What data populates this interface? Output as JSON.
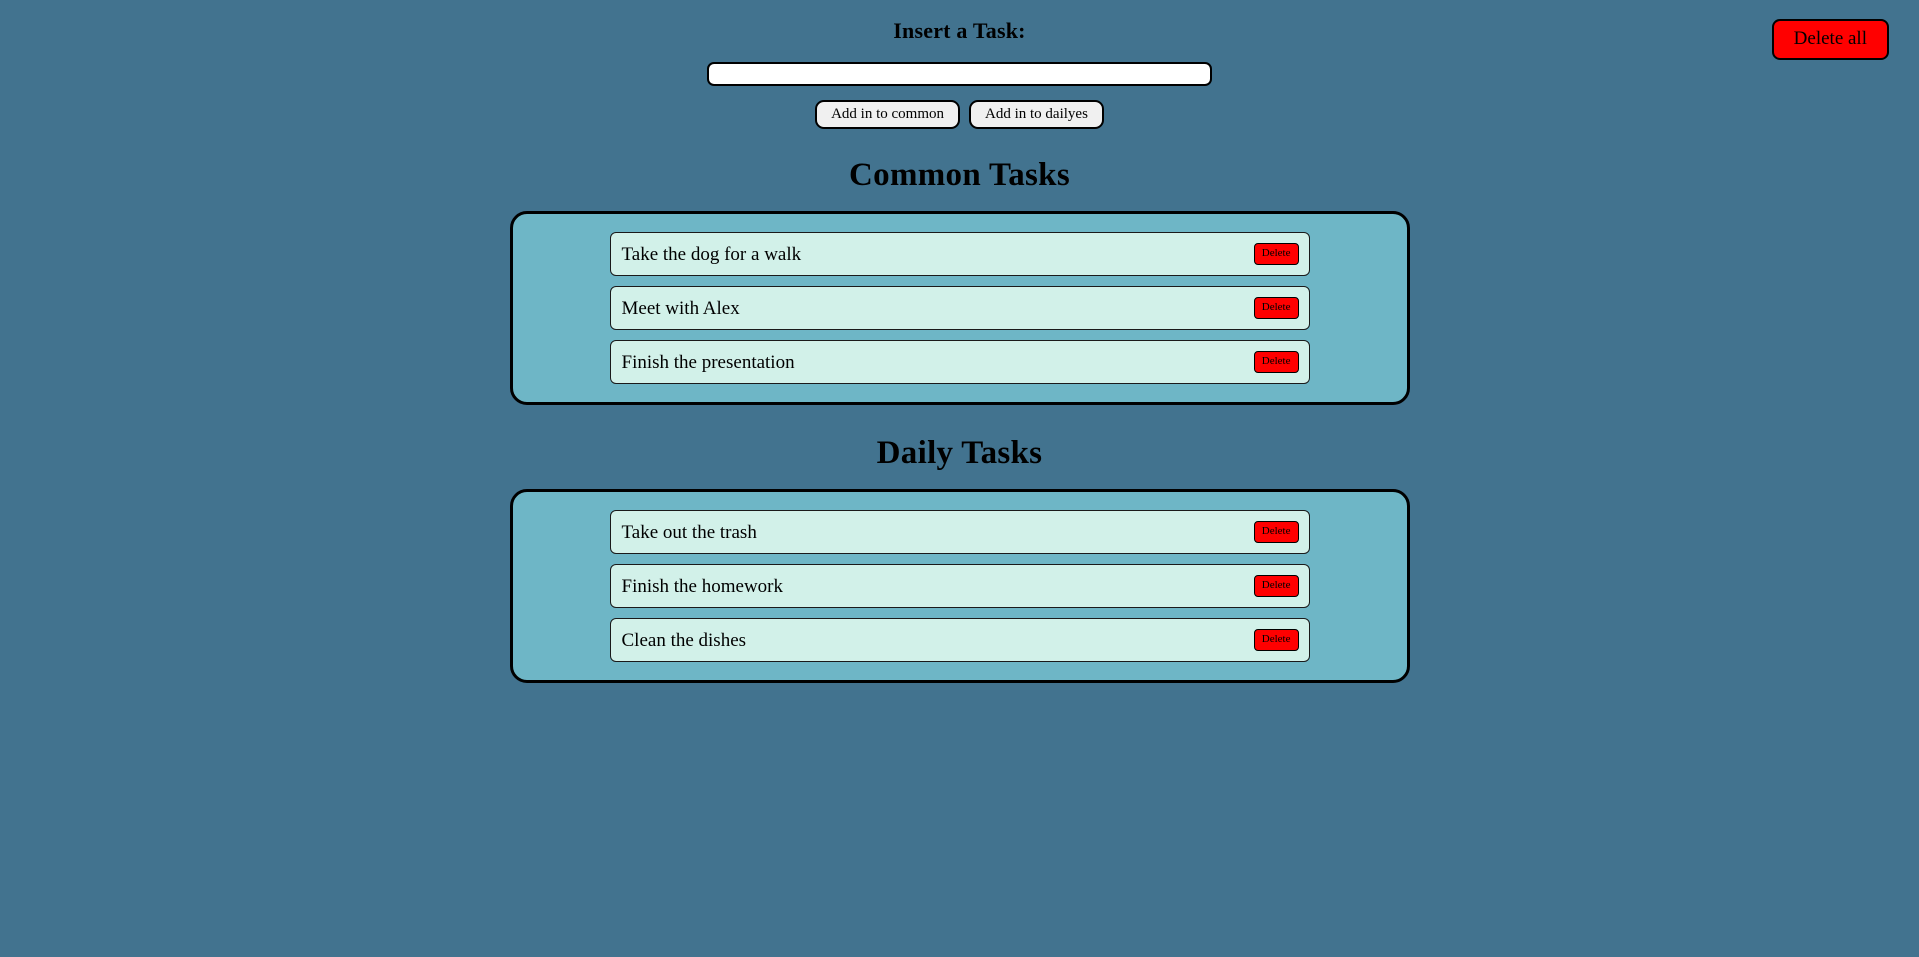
{
  "header": {
    "insert_heading": "Insert a Task:",
    "input_value": "",
    "input_placeholder": "",
    "add_common_label": "Add in to common",
    "add_daily_label": "Add in to dailyes",
    "delete_all_label": "Delete all"
  },
  "sections": [
    {
      "id": "common",
      "heading": "Common Tasks",
      "tasks": [
        {
          "label": "Take the dog for a walk",
          "delete_label": "Delete"
        },
        {
          "label": "Meet with Alex",
          "delete_label": "Delete"
        },
        {
          "label": "Finish the presentation",
          "delete_label": "Delete"
        }
      ]
    },
    {
      "id": "daily",
      "heading": "Daily Tasks",
      "tasks": [
        {
          "label": "Take out the trash",
          "delete_label": "Delete"
        },
        {
          "label": "Finish the homework",
          "delete_label": "Delete"
        },
        {
          "label": "Clean the dishes",
          "delete_label": "Delete"
        }
      ]
    }
  ],
  "colors": {
    "page_background": "#42738f",
    "panel_background": "#6eb6c6",
    "task_background": "#d2f1e9",
    "danger": "#ff0000",
    "button_face": "#f0f0f0",
    "border": "#000000"
  }
}
